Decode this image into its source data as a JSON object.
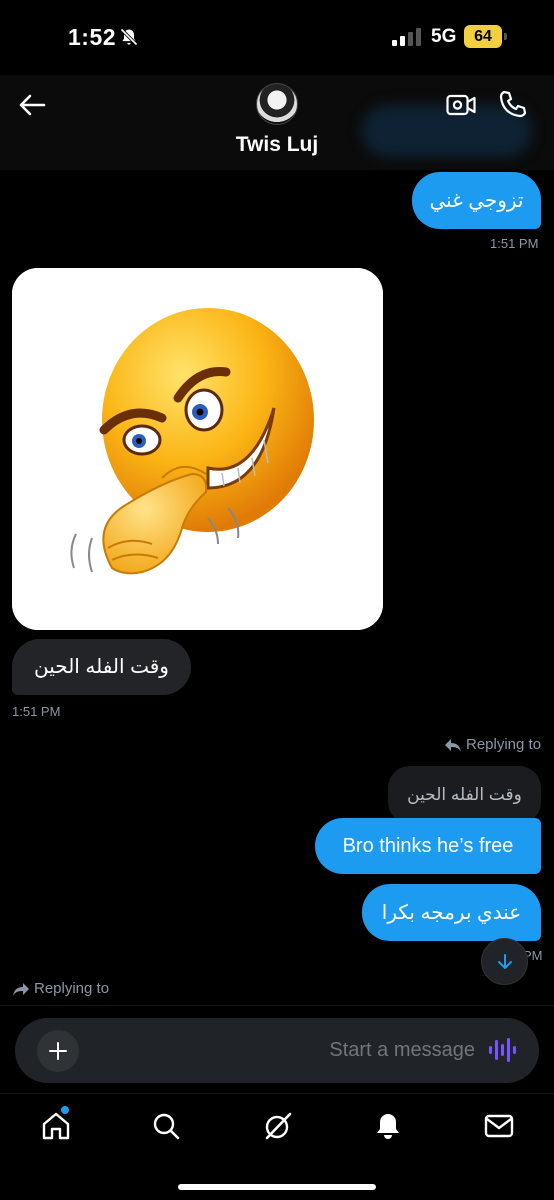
{
  "status_bar": {
    "time": "1:52",
    "network": "5G",
    "battery": "64",
    "icons": [
      "bell-off-icon",
      "signal-icon",
      "battery-icon"
    ]
  },
  "header": {
    "contact_name": "Twis Luj",
    "icons": [
      "back-arrow-icon",
      "video-call-icon",
      "phone-icon"
    ]
  },
  "messages": [
    {
      "direction": "outgoing",
      "text": "تزوجي غني",
      "time": "1:51 PM"
    },
    {
      "direction": "incoming",
      "type": "image",
      "alt": "emoji"
    },
    {
      "direction": "incoming",
      "text": "وقت الفله الحين",
      "time": "1:51 PM"
    },
    {
      "direction": "outgoing",
      "reply_label": "Replying to",
      "quoted": "وقت الفله الحين",
      "text": "Bro thinks he’s free"
    },
    {
      "direction": "outgoing",
      "text": "عندي برمجه بكرا",
      "time_partial": "PM"
    }
  ],
  "compose": {
    "reply_label": "Replying to",
    "placeholder": "Start a message"
  },
  "bottom_nav": [
    "home-icon",
    "search-icon",
    "grok-icon",
    "notifications-icon",
    "messages-icon"
  ],
  "colors": {
    "accent": "#1d9bf0",
    "incoming_bubble": "#222427",
    "background": "#000000",
    "battery": "#f2cf3f"
  }
}
